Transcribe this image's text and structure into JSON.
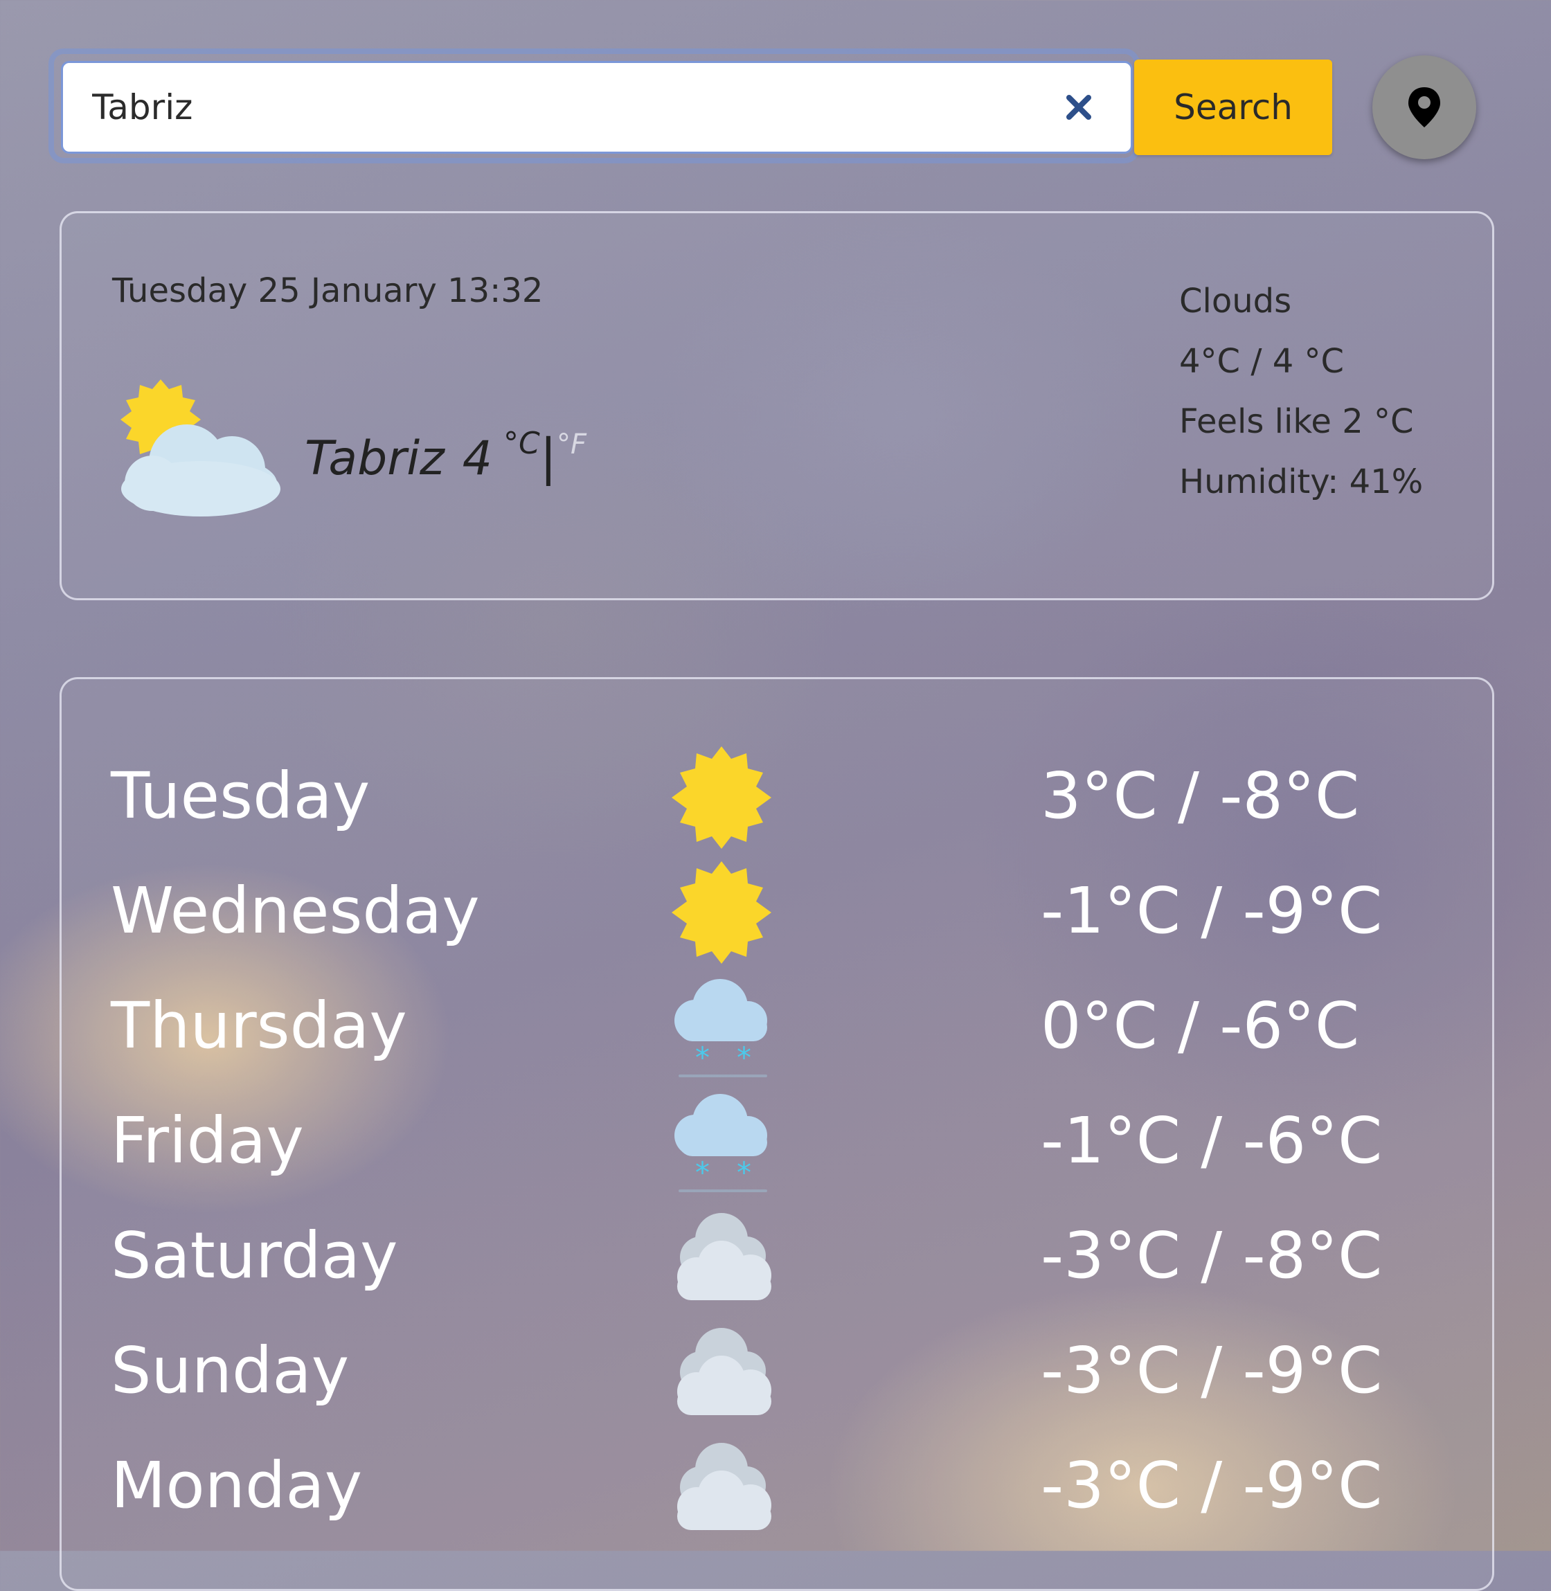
{
  "search": {
    "value": "Tabriz",
    "button_label": "Search"
  },
  "current": {
    "datetime": "Tuesday 25 January 13:32",
    "city": "Tabriz",
    "temp": "4",
    "unit_c": "°C",
    "unit_divider": "|",
    "unit_f": "°F",
    "icon": "partly-cloudy-icon",
    "condition": "Clouds",
    "high_low": "4°C / 4 °C",
    "feels_like": "Feels like 2 °C",
    "humidity": "Humidity: 41%"
  },
  "forecast": [
    {
      "day": "Tuesday",
      "icon": "sun-icon",
      "temps": "3°C / -8°C"
    },
    {
      "day": "Wednesday",
      "icon": "sun-icon",
      "temps": "-1°C / -9°C"
    },
    {
      "day": "Thursday",
      "icon": "snow-cloud-icon",
      "temps": "0°C / -6°C"
    },
    {
      "day": "Friday",
      "icon": "snow-cloud-icon",
      "temps": "-1°C / -6°C"
    },
    {
      "day": "Saturday",
      "icon": "cloud-icon",
      "temps": "-3°C / -8°C"
    },
    {
      "day": "Sunday",
      "icon": "cloud-icon",
      "temps": "-3°C / -9°C"
    },
    {
      "day": "Monday",
      "icon": "cloud-icon",
      "temps": "-3°C / -9°C"
    }
  ],
  "colors": {
    "search_button": "#fbbf10",
    "location_button": "#8f8f8f",
    "sun": "#fbd62a",
    "snow": "#4cc9ea",
    "cloud_light": "#dfe6ee",
    "cloud_blue": "#b9d8f0"
  }
}
